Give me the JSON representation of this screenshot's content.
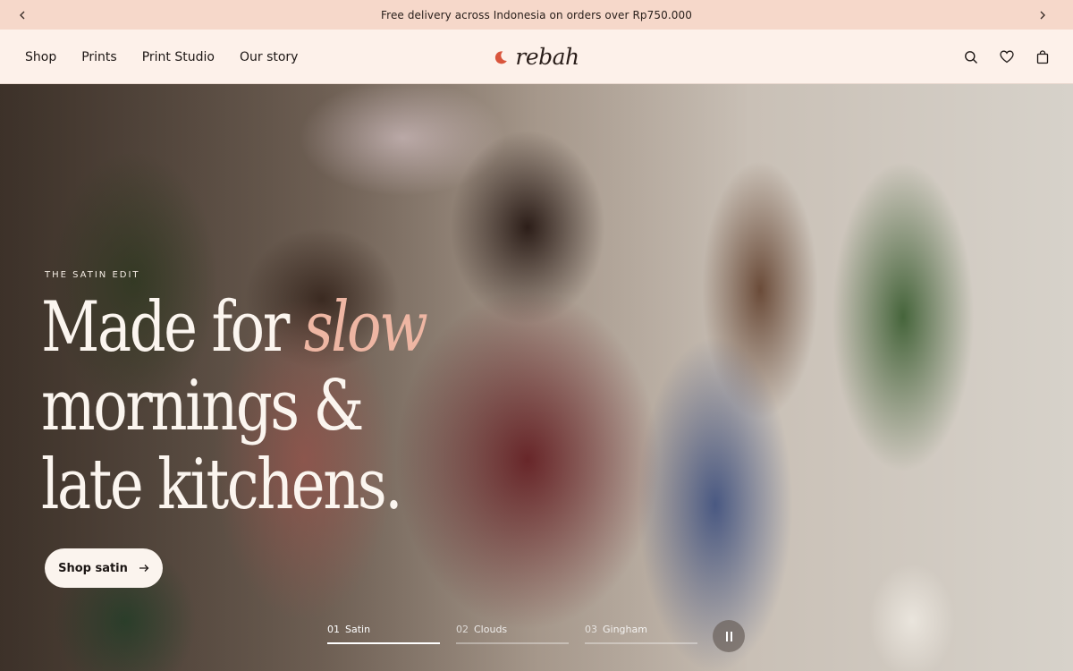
{
  "announcement": {
    "message": "Free delivery across Indonesia on orders over Rp750.000",
    "prev_icon": "chevron-left-icon",
    "next_icon": "chevron-right-icon"
  },
  "header": {
    "nav": [
      {
        "label": "Shop"
      },
      {
        "label": "Prints"
      },
      {
        "label": "Print Studio"
      },
      {
        "label": "Our story"
      }
    ],
    "logo": {
      "text": "rebah",
      "icon": "crescent-moon-icon",
      "icon_color": "#d9553c"
    },
    "icons": [
      "search-icon",
      "heart-icon",
      "bag-icon"
    ]
  },
  "hero": {
    "eyebrow": "THE SATIN EDIT",
    "headline": {
      "line1_prefix": "Made for ",
      "line1_accent": "slow",
      "line2": "mornings &",
      "line3": "late kitchens."
    },
    "accent_color": "#eeb6a3",
    "cta": {
      "label": "Shop satin",
      "icon": "arrow-right-icon"
    },
    "slides": [
      {
        "num": "01",
        "label": "Satin",
        "progress": 1.0,
        "active": true
      },
      {
        "num": "02",
        "label": "Clouds",
        "progress": 0,
        "active": false
      },
      {
        "num": "03",
        "label": "Gingham",
        "progress": 0,
        "active": false
      }
    ],
    "pause_icon": "pause-icon"
  }
}
